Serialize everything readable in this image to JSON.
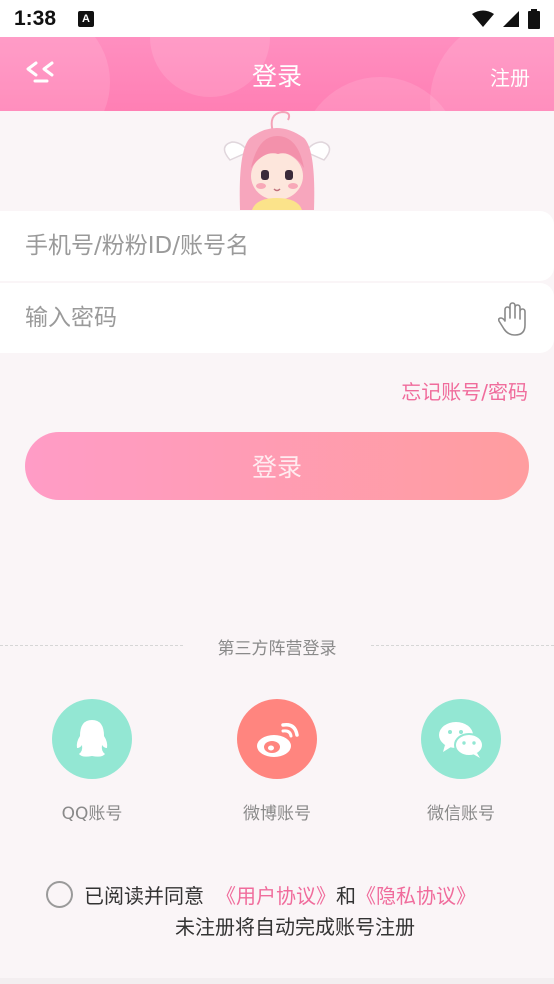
{
  "status_bar": {
    "time": "1:38",
    "notification_letter": "A"
  },
  "header": {
    "title": "登录",
    "register_label": "注册"
  },
  "form": {
    "account_placeholder": "手机号/粉粉ID/账号名",
    "account_value": "",
    "password_placeholder": "输入密码",
    "password_value": "",
    "forgot_label": "忘记账号/密码",
    "login_label": "登录"
  },
  "third_party": {
    "title": "第三方阵营登录",
    "options": [
      {
        "label": "QQ账号",
        "icon": "qq-icon",
        "color": "#93e7d3"
      },
      {
        "label": "微博账号",
        "icon": "weibo-icon",
        "color": "#ff857f"
      },
      {
        "label": "微信账号",
        "icon": "wechat-icon",
        "color": "#93e7d3"
      }
    ]
  },
  "agreement": {
    "prefix": "已阅读并同意",
    "user_agreement": "《用户协议》",
    "and": "和",
    "privacy_policy": "《隐私协议》",
    "auto_register_note": "未注册将自动完成账号注册"
  },
  "colors": {
    "accent": "#f06c9c",
    "header": "#ff85b8",
    "teal": "#93e7d3",
    "coral": "#ff857f"
  }
}
